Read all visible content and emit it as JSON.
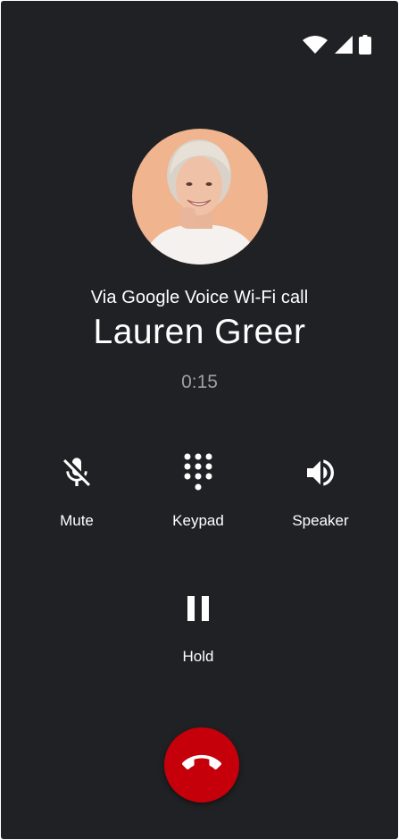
{
  "call": {
    "via": "Via Google Voice Wi-Fi call",
    "caller_name": "Lauren Greer",
    "duration": "0:15"
  },
  "controls": {
    "mute_label": "Mute",
    "keypad_label": "Keypad",
    "speaker_label": "Speaker",
    "hold_label": "Hold"
  },
  "icons": {
    "wifi": "wifi-icon",
    "signal": "cellular-signal-icon",
    "battery": "battery-icon",
    "mute": "mic-off-icon",
    "keypad": "dialpad-icon",
    "speaker": "volume-up-icon",
    "hold": "pause-icon",
    "end_call": "call-end-icon"
  },
  "colors": {
    "background": "#202124",
    "end_call": "#c5000a",
    "timer_text": "#9aa0a6",
    "avatar_bg": "#f0b48f"
  }
}
